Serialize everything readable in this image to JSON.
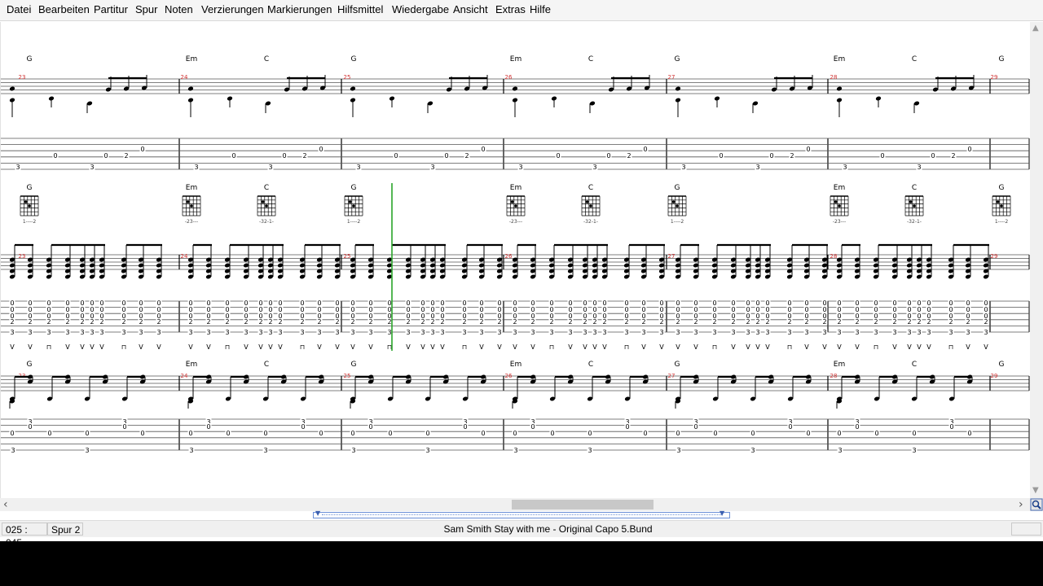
{
  "menu": [
    "Datei",
    "Bearbeiten",
    "Partitur",
    "Spur",
    "Noten",
    "Verzierungen",
    "Markierungen",
    "Hilfsmittel",
    "Wiedergabe",
    "Ansicht",
    "Extras",
    "Hilfe"
  ],
  "score": {
    "system1": {
      "chords": [
        "G",
        "Em",
        "C",
        "G",
        "Em",
        "C",
        "G",
        "Em",
        "C",
        "G"
      ],
      "measures": [
        "23",
        "24",
        "25",
        "26",
        "27",
        "28",
        "29"
      ]
    },
    "system2": {
      "chords": [
        "G",
        "Em",
        "C",
        "G",
        "Em",
        "C",
        "G",
        "Em",
        "C",
        "G"
      ],
      "chord_fingerings": [
        "1----2",
        "-23---",
        "-32-1-",
        "1----2",
        "-23---",
        "-32-1-",
        "1----2",
        "-23---",
        "-32-1-",
        "1----2"
      ],
      "measures": [
        "23",
        "24",
        "25",
        "26",
        "27",
        "28",
        "29"
      ]
    },
    "system3": {
      "chords": [
        "G",
        "Em",
        "C",
        "G",
        "Em",
        "C",
        "G",
        "Em",
        "C",
        "G"
      ],
      "measures": [
        "23",
        "24",
        "25",
        "26",
        "27",
        "28",
        "29"
      ]
    }
  },
  "status": {
    "position": "025 : 045",
    "track": "Spur 2",
    "title": "Sam Smith   Stay with me - Original  Capo 5.Bund"
  }
}
